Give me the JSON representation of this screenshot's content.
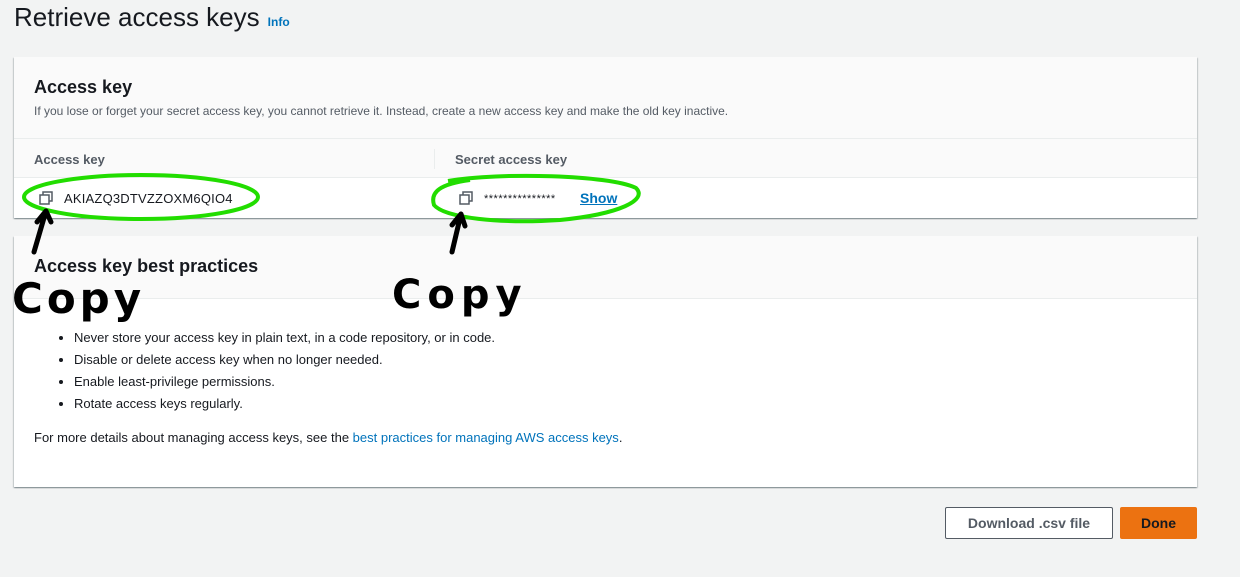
{
  "page": {
    "title": "Retrieve access keys",
    "info_link": "Info"
  },
  "access_key_panel": {
    "heading": "Access key",
    "description": "If you lose or forget your secret access key, you cannot retrieve it. Instead, create a new access key and make the old key inactive.",
    "columns": [
      "Access key",
      "Secret access key"
    ],
    "access_key_value": "AKIAZQ3DTVZZOXM6QIO4",
    "secret_key_masked": "***************",
    "show_label": "Show"
  },
  "best_practices_panel": {
    "heading": "Access key best practices",
    "items": [
      "Never store your access key in plain text, in a code repository, or in code.",
      "Disable or delete access key when no longer needed.",
      "Enable least-privilege permissions.",
      "Rotate access keys regularly."
    ],
    "more_details_prefix": "For more details about managing access keys, see the ",
    "more_details_link": "best practices for managing AWS access keys",
    "more_details_suffix": "."
  },
  "buttons": {
    "download_label": "Download .csv file",
    "done_label": "Done"
  },
  "annotations": {
    "left_label": "Copy",
    "right_label": "Copy",
    "highlight_color": "#22dd00",
    "ink_color": "#000000"
  },
  "colors": {
    "link": "#0073bb",
    "primary_button": "#ec7211",
    "background": "#f2f3f3"
  }
}
